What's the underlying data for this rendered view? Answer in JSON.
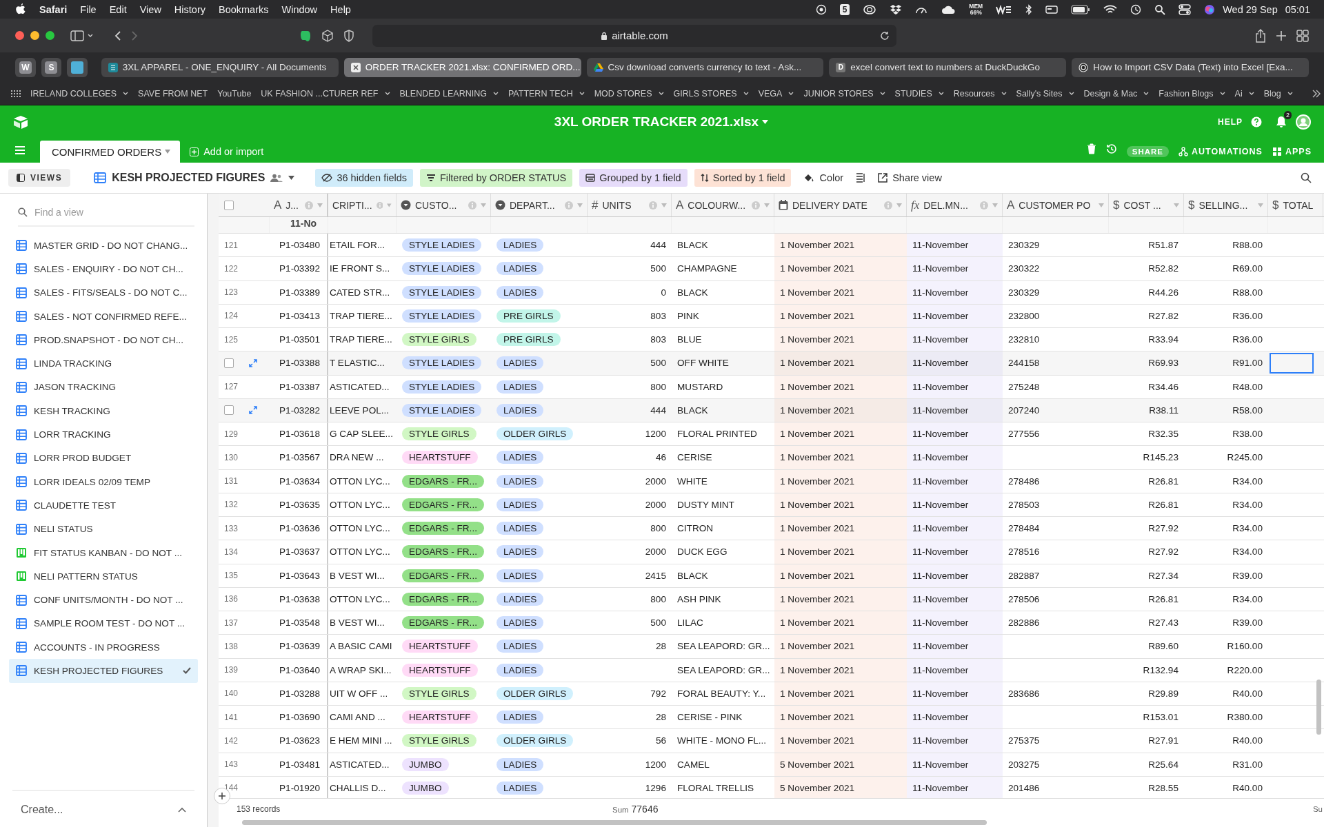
{
  "menubar": {
    "app": "Safari",
    "menus": [
      "File",
      "Edit",
      "View",
      "History",
      "Bookmarks",
      "Window",
      "Help"
    ],
    "status_box": "5",
    "mem_label": "MEM",
    "mem_value": "66%",
    "date": "Wed 29 Sep",
    "time": "05:01"
  },
  "browser": {
    "address": "airtable.com",
    "pinned_tabs": [
      {
        "kind": "letter",
        "text": "W"
      },
      {
        "kind": "letter",
        "text": "S"
      },
      {
        "kind": "square"
      }
    ],
    "tabs": [
      {
        "title": "3XL APPAREL - ONE_ENQUIRY - All Documents",
        "kind": "sheet",
        "selected": false
      },
      {
        "title": "ORDER TRACKER 2021.xlsx: CONFIRMED ORD...",
        "kind": "close",
        "selected": true
      },
      {
        "title": "Csv download converts currency to text - Ask...",
        "kind": "drive",
        "selected": false
      },
      {
        "title": "excel convert text to numbers at DuckDuckGo",
        "kind": "letter",
        "favicon_text": "D",
        "selected": false
      },
      {
        "title": "How to Import CSV Data (Text) into Excel [Exa...",
        "kind": "ring",
        "selected": false
      }
    ],
    "bookmarks": [
      {
        "label": "IRELAND COLLEGES",
        "folder": true
      },
      {
        "label": "SAVE FROM NET",
        "folder": false
      },
      {
        "label": "YouTube",
        "folder": false
      },
      {
        "label": "UK FASHION ...CTURER REF",
        "folder": true
      },
      {
        "label": "BLENDED LEARNING",
        "folder": true
      },
      {
        "label": "PATTERN TECH",
        "folder": true
      },
      {
        "label": "MOD STORES",
        "folder": true
      },
      {
        "label": "GIRLS STORES",
        "folder": true
      },
      {
        "label": "VEGA",
        "folder": true
      },
      {
        "label": "JUNIOR STORES",
        "folder": true
      },
      {
        "label": "STUDIES",
        "folder": true
      },
      {
        "label": "Resources",
        "folder": true
      },
      {
        "label": "Sally's Sites",
        "folder": true
      },
      {
        "label": "Design & Mac",
        "folder": true
      },
      {
        "label": "Fashion Blogs",
        "folder": true
      },
      {
        "label": "Ai",
        "folder": true
      },
      {
        "label": "Blog",
        "folder": true
      }
    ]
  },
  "app": {
    "base_title": "3XL ORDER TRACKER 2021.xlsx",
    "help": "HELP",
    "notifications": "2",
    "tables": [
      {
        "label": "CONFIRMED ORDERS",
        "selected": true
      }
    ],
    "add_table": "Add or import",
    "share": "SHARE",
    "automations": "AUTOMATIONS",
    "apps": "APPS"
  },
  "toolbar": {
    "views": "VIEWS",
    "view_name": "KESH PROJECTED FIGURES",
    "chips": [
      {
        "label": "36 hidden fields",
        "kind": "hide",
        "color": "#d0ecfa"
      },
      {
        "label": "Filtered by ORDER STATUS",
        "kind": "filter",
        "color": "#d1f4c8"
      },
      {
        "label": "Grouped by 1 field",
        "kind": "group",
        "color": "#e6dcfa"
      },
      {
        "label": "Sorted by 1 field",
        "kind": "sort",
        "color": "#fde2d5"
      }
    ],
    "color_label": "Color",
    "share_view": "Share view"
  },
  "sidebar": {
    "search_placeholder": "Find a view",
    "views": [
      {
        "label": "MASTER GRID - DO NOT CHANG...",
        "kind": "grid",
        "selected": false
      },
      {
        "label": "SALES - ENQUIRY - DO NOT CH...",
        "kind": "grid",
        "selected": false
      },
      {
        "label": "SALES - FITS/SEALS - DO NOT C...",
        "kind": "grid",
        "selected": false
      },
      {
        "label": "SALES - NOT CONFIRMED REFE...",
        "kind": "grid",
        "selected": false
      },
      {
        "label": "PROD.SNAPSHOT - DO NOT CH...",
        "kind": "grid",
        "selected": false
      },
      {
        "label": "LINDA TRACKING",
        "kind": "grid",
        "selected": false
      },
      {
        "label": "JASON TRACKING",
        "kind": "grid",
        "selected": false
      },
      {
        "label": "KESH TRACKING",
        "kind": "grid",
        "selected": false
      },
      {
        "label": "LORR TRACKING",
        "kind": "grid",
        "selected": false
      },
      {
        "label": "LORR PROD BUDGET",
        "kind": "grid",
        "selected": false
      },
      {
        "label": "LORR IDEALS 02/09 TEMP",
        "kind": "grid",
        "selected": false
      },
      {
        "label": "CLAUDETTE TEST",
        "kind": "grid",
        "selected": false
      },
      {
        "label": "NELI STATUS",
        "kind": "grid",
        "selected": false
      },
      {
        "label": "FIT STATUS KANBAN - DO NOT ...",
        "kind": "kanban",
        "selected": false
      },
      {
        "label": "NELI PATTERN STATUS",
        "kind": "kanban",
        "selected": false
      },
      {
        "label": "CONF UNITS/MONTH - DO NOT ...",
        "kind": "grid",
        "selected": false
      },
      {
        "label": "SAMPLE ROOM TEST - DO NOT ...",
        "kind": "grid",
        "selected": false
      },
      {
        "label": "ACCOUNTS - IN PROGRESS",
        "kind": "grid",
        "selected": false
      },
      {
        "label": "KESH PROJECTED FIGURES",
        "kind": "grid",
        "selected": true
      }
    ],
    "create": "Create..."
  },
  "table": {
    "all_selected": false,
    "columns": [
      {
        "label": "J...",
        "kind": "text",
        "glyph": "A"
      },
      {
        "label": "CRIPTI...",
        "kind": "text"
      },
      {
        "label": "CUSTO...",
        "kind": "select"
      },
      {
        "label": "DEPART...",
        "kind": "select"
      },
      {
        "label": "UNITS",
        "kind": "number",
        "glyph": "#"
      },
      {
        "label": "COLOURW...",
        "kind": "text",
        "glyph": "A"
      },
      {
        "label": "DELIVERY DATE",
        "kind": "date"
      },
      {
        "label": "DEL.MN...",
        "kind": "formula",
        "glyph": "fx"
      },
      {
        "label": "CUSTOMER PO",
        "kind": "text",
        "glyph": "A"
      },
      {
        "label": "COST ...",
        "kind": "currency",
        "glyph": "$"
      },
      {
        "label": "SELLING...",
        "kind": "currency",
        "glyph": "$"
      },
      {
        "label": "TOTAL",
        "kind": "currency",
        "glyph": "$"
      }
    ],
    "group_label": "11-No",
    "rows": [
      {
        "number": "121",
        "hovered": false,
        "job": "P1-03480",
        "description": "ETAIL FOR...",
        "customer": {
          "text": "STYLE LADIES",
          "color": "#cfdfff"
        },
        "department": {
          "text": "LADIES",
          "color": "#cfdfff"
        },
        "units": "444",
        "colour": "BLACK",
        "delivery_date": "1 November 2021",
        "del_month": "11-November",
        "customer_po": "230329",
        "cost": "R51.87",
        "selling": "R88.00",
        "total_selected": false
      },
      {
        "number": "122",
        "hovered": false,
        "job": "P1-03392",
        "description": "IE FRONT S...",
        "customer": {
          "text": "STYLE LADIES",
          "color": "#cfdfff"
        },
        "department": {
          "text": "LADIES",
          "color": "#cfdfff"
        },
        "units": "500",
        "colour": "CHAMPAGNE",
        "delivery_date": "1 November 2021",
        "del_month": "11-November",
        "customer_po": "230322",
        "cost": "R52.82",
        "selling": "R69.00",
        "total_selected": false
      },
      {
        "number": "123",
        "hovered": false,
        "job": "P1-03389",
        "description": "CATED STR...",
        "customer": {
          "text": "STYLE LADIES",
          "color": "#cfdfff"
        },
        "department": {
          "text": "LADIES",
          "color": "#cfdfff"
        },
        "units": "0",
        "colour": "BLACK",
        "delivery_date": "1 November 2021",
        "del_month": "11-November",
        "customer_po": "230329",
        "cost": "R44.26",
        "selling": "R88.00",
        "total_selected": false
      },
      {
        "number": "124",
        "hovered": false,
        "job": "P1-03413",
        "description": "TRAP TIERE...",
        "customer": {
          "text": "STYLE LADIES",
          "color": "#cfdfff"
        },
        "department": {
          "text": "PRE GIRLS",
          "color": "#c2f5e9"
        },
        "units": "803",
        "colour": "PINK",
        "delivery_date": "1 November 2021",
        "del_month": "11-November",
        "customer_po": "232800",
        "cost": "R27.82",
        "selling": "R36.00",
        "total_selected": false
      },
      {
        "number": "125",
        "hovered": false,
        "job": "P1-03501",
        "description": "TRAP TIERE...",
        "customer": {
          "text": "STYLE GIRLS",
          "color": "#d1f7c4"
        },
        "department": {
          "text": "PRE GIRLS",
          "color": "#c2f5e9"
        },
        "units": "803",
        "colour": "BLUE",
        "delivery_date": "1 November 2021",
        "del_month": "11-November",
        "customer_po": "232810",
        "cost": "R33.94",
        "selling": "R36.00",
        "total_selected": false
      },
      {
        "hovered": true,
        "job": "P1-03388",
        "description": "T ELASTIC...",
        "customer": {
          "text": "STYLE LADIES",
          "color": "#cfdfff"
        },
        "department": {
          "text": "LADIES",
          "color": "#cfdfff"
        },
        "units": "500",
        "colour": "OFF WHITE",
        "delivery_date": "1 November 2021",
        "del_month": "11-November",
        "customer_po": "244158",
        "cost": "R69.93",
        "selling": "R91.00",
        "total_selected": true
      },
      {
        "number": "127",
        "hovered": false,
        "job": "P1-03387",
        "description": "ASTICATED...",
        "customer": {
          "text": "STYLE LADIES",
          "color": "#cfdfff"
        },
        "department": {
          "text": "LADIES",
          "color": "#cfdfff"
        },
        "units": "800",
        "colour": "MUSTARD",
        "delivery_date": "1 November 2021",
        "del_month": "11-November",
        "customer_po": "275248",
        "cost": "R34.46",
        "selling": "R48.00",
        "total_selected": false
      },
      {
        "hovered": true,
        "job": "P1-03282",
        "description": "LEEVE POL...",
        "customer": {
          "text": "STYLE LADIES",
          "color": "#cfdfff"
        },
        "department": {
          "text": "LADIES",
          "color": "#cfdfff"
        },
        "units": "444",
        "colour": "BLACK",
        "delivery_date": "1 November 2021",
        "del_month": "11-November",
        "customer_po": "207240",
        "cost": "R38.11",
        "selling": "R58.00",
        "total_selected": false
      },
      {
        "number": "129",
        "hovered": false,
        "job": "P1-03618",
        "description": "G CAP SLEE...",
        "customer": {
          "text": "STYLE GIRLS",
          "color": "#d1f7c4"
        },
        "department": {
          "text": "OLDER GIRLS",
          "color": "#d0f0fd"
        },
        "units": "1200",
        "colour": "FLORAL PRINTED",
        "delivery_date": "1 November 2021",
        "del_month": "11-November",
        "customer_po": "277556",
        "cost": "R32.35",
        "selling": "R38.00",
        "total_selected": false
      },
      {
        "number": "130",
        "hovered": false,
        "job": "P1-03567",
        "description": "DRA NEW ...",
        "customer": {
          "text": "HEARTSTUFF",
          "color": "#ffdaf6"
        },
        "department": {
          "text": "LADIES",
          "color": "#cfdfff"
        },
        "units": "46",
        "colour": "CERISE",
        "delivery_date": "1 November 2021",
        "del_month": "11-November",
        "cost": "R145.23",
        "selling": "R245.00",
        "total_selected": false
      },
      {
        "number": "131",
        "hovered": false,
        "job": "P1-03634",
        "description": "OTTON LYC...",
        "customer": {
          "text": "EDGARS - FR...",
          "color": "#93e088"
        },
        "department": {
          "text": "LADIES",
          "color": "#cfdfff"
        },
        "units": "2000",
        "colour": "WHITE",
        "delivery_date": "1 November 2021",
        "del_month": "11-November",
        "customer_po": "278486",
        "cost": "R26.81",
        "selling": "R34.00",
        "total_selected": false
      },
      {
        "number": "132",
        "hovered": false,
        "job": "P1-03635",
        "description": "OTTON LYC...",
        "customer": {
          "text": "EDGARS - FR...",
          "color": "#93e088"
        },
        "department": {
          "text": "LADIES",
          "color": "#cfdfff"
        },
        "units": "2000",
        "colour": "DUSTY MINT",
        "delivery_date": "1 November 2021",
        "del_month": "11-November",
        "customer_po": "278503",
        "cost": "R26.81",
        "selling": "R34.00",
        "total_selected": false
      },
      {
        "number": "133",
        "hovered": false,
        "job": "P1-03636",
        "description": "OTTON LYC...",
        "customer": {
          "text": "EDGARS - FR...",
          "color": "#93e088"
        },
        "department": {
          "text": "LADIES",
          "color": "#cfdfff"
        },
        "units": "800",
        "colour": "CITRON",
        "delivery_date": "1 November 2021",
        "del_month": "11-November",
        "customer_po": "278484",
        "cost": "R27.92",
        "selling": "R34.00",
        "total_selected": false
      },
      {
        "number": "134",
        "hovered": false,
        "job": "P1-03637",
        "description": "OTTON LYC...",
        "customer": {
          "text": "EDGARS - FR...",
          "color": "#93e088"
        },
        "department": {
          "text": "LADIES",
          "color": "#cfdfff"
        },
        "units": "2000",
        "colour": "DUCK EGG",
        "delivery_date": "1 November 2021",
        "del_month": "11-November",
        "customer_po": "278516",
        "cost": "R27.92",
        "selling": "R34.00",
        "total_selected": false
      },
      {
        "number": "135",
        "hovered": false,
        "job": "P1-03643",
        "description": "B VEST WI...",
        "customer": {
          "text": "EDGARS - FR...",
          "color": "#93e088"
        },
        "department": {
          "text": "LADIES",
          "color": "#cfdfff"
        },
        "units": "2415",
        "colour": "BLACK",
        "delivery_date": "1 November 2021",
        "del_month": "11-November",
        "customer_po": "282887",
        "cost": "R27.34",
        "selling": "R39.00",
        "total_selected": false
      },
      {
        "number": "136",
        "hovered": false,
        "job": "P1-03638",
        "description": "OTTON LYC...",
        "customer": {
          "text": "EDGARS - FR...",
          "color": "#93e088"
        },
        "department": {
          "text": "LADIES",
          "color": "#cfdfff"
        },
        "units": "800",
        "colour": "ASH PINK",
        "delivery_date": "1 November 2021",
        "del_month": "11-November",
        "customer_po": "278506",
        "cost": "R26.81",
        "selling": "R34.00",
        "total_selected": false
      },
      {
        "number": "137",
        "hovered": false,
        "job": "P1-03548",
        "description": "B VEST WI...",
        "customer": {
          "text": "EDGARS - FR...",
          "color": "#93e088"
        },
        "department": {
          "text": "LADIES",
          "color": "#cfdfff"
        },
        "units": "500",
        "colour": "LILAC",
        "delivery_date": "1 November 2021",
        "del_month": "11-November",
        "customer_po": "282886",
        "cost": "R27.43",
        "selling": "R39.00",
        "total_selected": false
      },
      {
        "number": "138",
        "hovered": false,
        "job": "P1-03639",
        "description": "A BASIC CAMI",
        "customer": {
          "text": "HEARTSTUFF",
          "color": "#ffdaf6"
        },
        "department": {
          "text": "LADIES",
          "color": "#cfdfff"
        },
        "units": "28",
        "colour": "SEA LEAPORD: GR...",
        "delivery_date": "1 November 2021",
        "del_month": "11-November",
        "cost": "R89.60",
        "selling": "R160.00",
        "total_selected": false
      },
      {
        "number": "139",
        "hovered": false,
        "job": "P1-03640",
        "description": "A WRAP SKI...",
        "customer": {
          "text": "HEARTSTUFF",
          "color": "#ffdaf6"
        },
        "department": {
          "text": "LADIES",
          "color": "#cfdfff"
        },
        "colour": "SEA LEAPORD: GR...",
        "delivery_date": "1 November 2021",
        "del_month": "11-November",
        "cost": "R132.94",
        "selling": "R220.00",
        "total_selected": false
      },
      {
        "number": "140",
        "hovered": false,
        "job": "P1-03288",
        "description": "UIT W OFF ...",
        "customer": {
          "text": "STYLE GIRLS",
          "color": "#d1f7c4"
        },
        "department": {
          "text": "OLDER GIRLS",
          "color": "#d0f0fd"
        },
        "units": "792",
        "colour": "FORAL BEAUTY: Y...",
        "delivery_date": "1 November 2021",
        "del_month": "11-November",
        "customer_po": "283686",
        "cost": "R29.89",
        "selling": "R40.00",
        "total_selected": false
      },
      {
        "number": "141",
        "hovered": false,
        "job": "P1-03690",
        "description": "CAMI AND ...",
        "customer": {
          "text": "HEARTSTUFF",
          "color": "#ffdaf6"
        },
        "department": {
          "text": "LADIES",
          "color": "#cfdfff"
        },
        "units": "28",
        "colour": "CERISE - PINK",
        "delivery_date": "1 November 2021",
        "del_month": "11-November",
        "cost": "R153.01",
        "selling": "R380.00",
        "total_selected": false
      },
      {
        "number": "142",
        "hovered": false,
        "job": "P1-03623",
        "description": "E HEM MINI ...",
        "customer": {
          "text": "STYLE GIRLS",
          "color": "#d1f7c4"
        },
        "department": {
          "text": "OLDER GIRLS",
          "color": "#d0f0fd"
        },
        "units": "56",
        "colour": "WHITE - MONO FL...",
        "delivery_date": "1 November 2021",
        "del_month": "11-November",
        "customer_po": "275375",
        "cost": "R27.91",
        "selling": "R40.00",
        "total_selected": false
      },
      {
        "number": "143",
        "hovered": false,
        "job": "P1-03481",
        "description": "ASTICATED...",
        "customer": {
          "text": "JUMBO",
          "color": "#ede2fe"
        },
        "department": {
          "text": "LADIES",
          "color": "#cfdfff"
        },
        "units": "1200",
        "colour": "CAMEL",
        "delivery_date": "5 November 2021",
        "del_month": "11-November",
        "customer_po": "203275",
        "cost": "R25.64",
        "selling": "R31.00",
        "total_selected": false
      },
      {
        "number": "144",
        "hovered": false,
        "job": "P1-01920",
        "description": "CHALLIS D...",
        "customer": {
          "text": "JUMBO",
          "color": "#ede2fe"
        },
        "department": {
          "text": "LADIES",
          "color": "#cfdfff"
        },
        "units": "1296",
        "colour": "FLORAL TRELLIS",
        "delivery_date": "5 November 2021",
        "del_month": "11-November",
        "customer_po": "201486",
        "cost": "R28.55",
        "selling": "R40.00",
        "total_selected": false
      }
    ],
    "footer": {
      "records": "153 records",
      "sum_label": "Sum",
      "sum_value": "77646",
      "cut_label": "Su"
    }
  }
}
